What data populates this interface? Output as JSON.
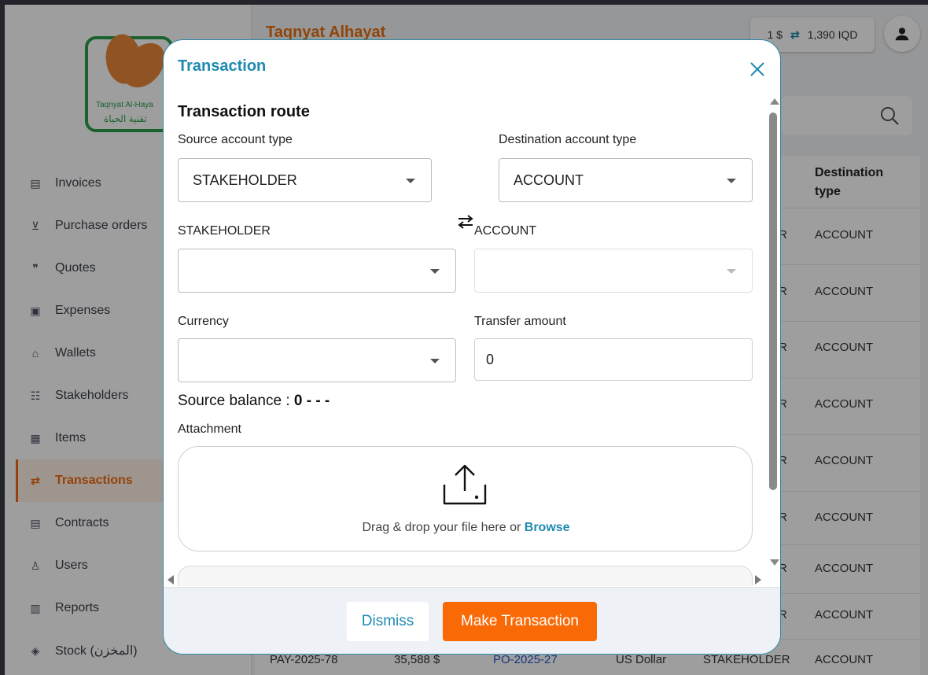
{
  "app": {
    "brand": "Taqnyat Alhayat",
    "logo_text_en": "Taqnyat Al-Haya",
    "logo_text_ar": "تقنية الحياة",
    "rate": {
      "left": "1 $",
      "right": "1,390 IQD"
    }
  },
  "sidebar": {
    "items": [
      {
        "label": "Invoices",
        "icon": "invoice-icon"
      },
      {
        "label": "Purchase orders",
        "icon": "cart-icon"
      },
      {
        "label": "Quotes",
        "icon": "quote-icon"
      },
      {
        "label": "Expenses",
        "icon": "money-icon"
      },
      {
        "label": "Wallets",
        "icon": "bank-icon"
      },
      {
        "label": "Stakeholders",
        "icon": "group-icon"
      },
      {
        "label": "Items",
        "icon": "items-icon"
      },
      {
        "label": "Transactions",
        "icon": "transfer-icon"
      },
      {
        "label": "Contracts",
        "icon": "contract-icon"
      },
      {
        "label": "Users",
        "icon": "user-icon"
      },
      {
        "label": "Reports",
        "icon": "report-icon"
      },
      {
        "label": "Stock (المخزن)",
        "icon": "box-icon"
      }
    ],
    "active_index": 7
  },
  "table": {
    "header": "Destination type",
    "cells": [
      "ACCOUNT",
      "ACCOUNT",
      "ACCOUNT",
      "ACCOUNT",
      "ACCOUNT",
      "ACCOUNT",
      "ACCOUNT",
      "ACCOUNT",
      "ACCOUNT"
    ],
    "partial": "R",
    "last_row": {
      "id": "PAY-2025-78",
      "amount": "35,588 $",
      "po": "PO-2025-27",
      "currency": "US Dollar",
      "source": "STAKEHOLDER",
      "dest": "ACCOUNT"
    }
  },
  "modal": {
    "title": "Transaction",
    "section_title": "Transaction route",
    "source_type_label": "Source account type",
    "source_type_value": "STAKEHOLDER",
    "dest_type_label": "Destination account type",
    "dest_type_value": "ACCOUNT",
    "stakeholder_label": "STAKEHOLDER",
    "account_label": "ACCOUNT",
    "currency_label": "Currency",
    "amount_label": "Transfer amount",
    "amount_value": "0",
    "balance_label": "Source balance :",
    "balance_value": "0 - - -",
    "attachment_label": "Attachment",
    "drop_text": "Drag & drop your file here or",
    "browse_label": "Browse",
    "dismiss_label": "Dismiss",
    "submit_label": "Make Transaction"
  },
  "colors": {
    "accent": "#1f8bb0",
    "primary": "#f96a07",
    "brand": "#e8700f"
  }
}
